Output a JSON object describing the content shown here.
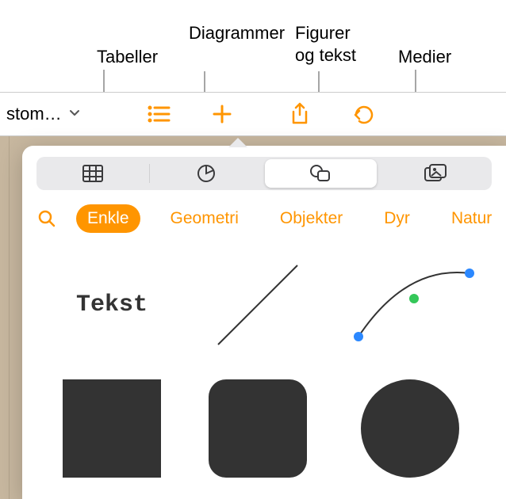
{
  "callouts": {
    "tables": "Tabeller",
    "charts": "Diagrammer",
    "shapes_text": "Figurer\nog tekst",
    "media": "Medier"
  },
  "toolbar": {
    "title": "stom…"
  },
  "segments": {
    "tables": "tables-icon",
    "charts": "charts-icon",
    "shapes": "shapes-icon",
    "media": "media-icon"
  },
  "categories": {
    "simple": "Enkle",
    "geometry": "Geometri",
    "objects": "Objekter",
    "animals": "Dyr",
    "nature": "Natur"
  },
  "shapes": {
    "text_label": "Tekst"
  },
  "colors": {
    "accent": "#ff9500",
    "shape_fill": "#333333",
    "segmented_bg": "#e9e9eb",
    "stage_bg": "#c7b79f"
  }
}
